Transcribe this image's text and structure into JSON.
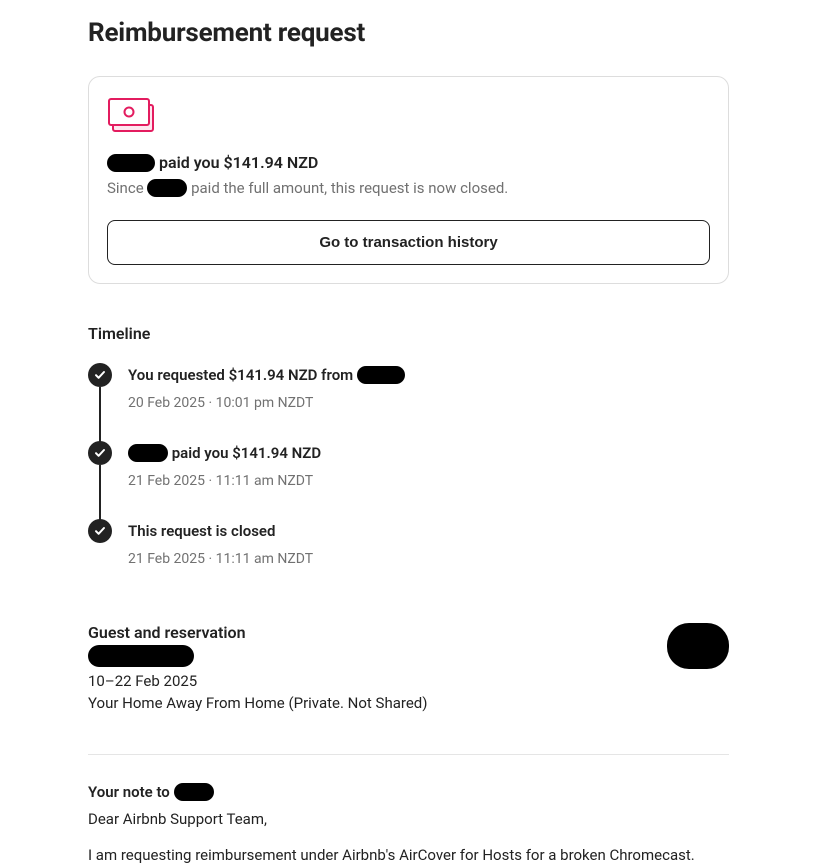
{
  "page_title": "Reimbursement request",
  "card": {
    "title_before": "",
    "title_after": " paid you $141.94 NZD",
    "sub_before": "Since ",
    "sub_after": " paid the full amount, this request is now closed.",
    "button_label": "Go to transaction history"
  },
  "timeline_heading": "Timeline",
  "timeline": [
    {
      "title_before": "You requested $141.94 NZD from ",
      "title_after": "",
      "meta": "20 Feb 2025 · 10:01 pm NZDT",
      "redact_after": true
    },
    {
      "title_before": "",
      "title_after": " paid you $141.94 NZD",
      "meta": "21 Feb 2025 · 11:11 am NZDT",
      "redact_before": true
    },
    {
      "title_before": "This request is closed",
      "title_after": "",
      "meta": "21 Feb 2025 · 11:11 am NZDT"
    }
  ],
  "guest": {
    "heading": "Guest and reservation",
    "dates": "10–22 Feb 2025",
    "listing": "Your Home Away From Home (Private. Not Shared)"
  },
  "note": {
    "heading_before": "Your note to ",
    "heading_after": "",
    "para1": "Dear Airbnb Support Team,",
    "para2": "I am requesting reimbursement under Airbnb's AirCover for Hosts for a broken Chromecast."
  }
}
